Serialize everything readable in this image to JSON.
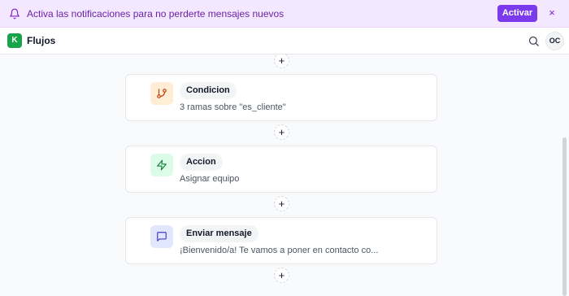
{
  "banner": {
    "message": "Activa las notificaciones para no perderte mensajes nuevos",
    "activate_label": "Activar",
    "close_glyph": "×",
    "bell_icon": "bell-icon",
    "background": "#f3e8ff",
    "accent": "#7c3aed"
  },
  "header": {
    "logo_letter": "K",
    "title": "Flujos",
    "search_icon": "search-icon",
    "avatar_initials": "OC",
    "logo_color": "#16a34a"
  },
  "flow": {
    "add_glyph": "+",
    "steps": [
      {
        "tag": "Condicion",
        "description": "3 ramas sobre \"es_cliente\"",
        "icon": "git-branch-icon",
        "icon_bg": "#ffedd5",
        "icon_color": "#c2410c"
      },
      {
        "tag": "Accion",
        "description": "Asignar equipo",
        "icon": "lightning-icon",
        "icon_bg": "#dcfce7",
        "icon_color": "#15803d"
      },
      {
        "tag": "Enviar mensaje",
        "description": "¡Bienvenido/a! Te vamos a poner en contacto co...",
        "icon": "message-icon",
        "icon_bg": "#e0e7ff",
        "icon_color": "#4338ca"
      }
    ]
  }
}
